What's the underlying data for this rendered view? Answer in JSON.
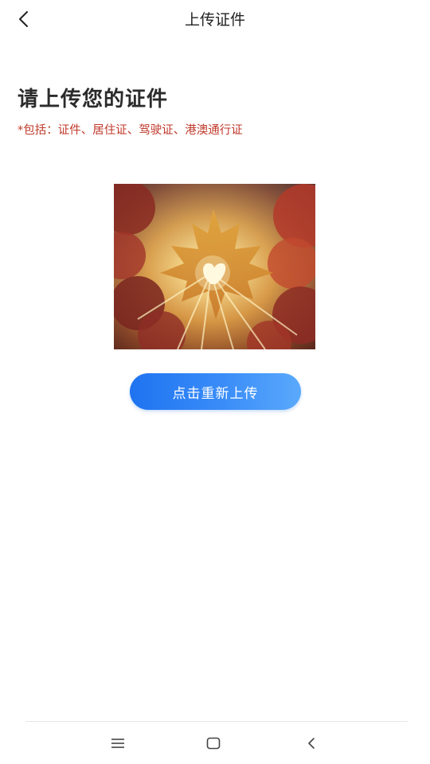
{
  "header": {
    "title": "上传证件"
  },
  "content": {
    "heading": "请上传您的证件",
    "hint": "*包括：证件、居住证、驾驶证、港澳通行证",
    "reupload_label": "点击重新上传"
  },
  "colors": {
    "hint": "#c0392b",
    "button_start": "#1f73f0",
    "button_end": "#5aa9fc"
  },
  "icons": {
    "back": "chevron-left-icon",
    "menu": "menu-icon",
    "home": "home-square-icon",
    "nav_back": "chevron-left-icon"
  }
}
